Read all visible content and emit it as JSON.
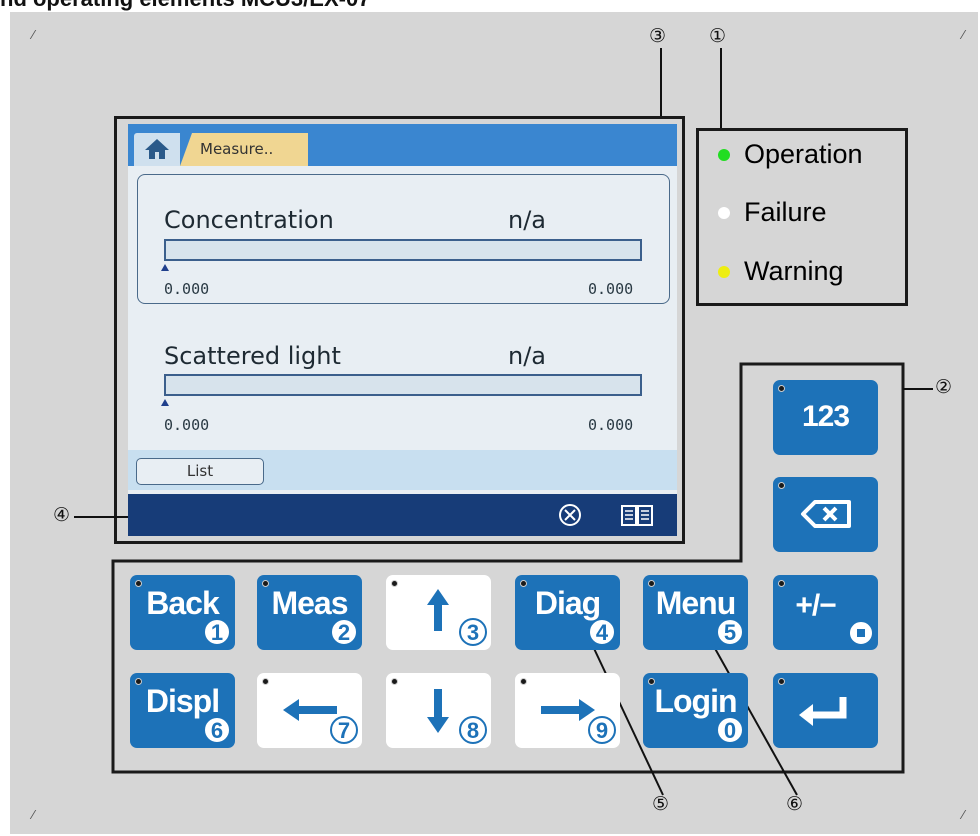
{
  "header": {
    "title": "nd operating elements MCU3/EX-07"
  },
  "callouts": {
    "c1": "①",
    "c2": "②",
    "c3": "③",
    "c4": "④",
    "c5": "⑤",
    "c6": "⑥"
  },
  "display": {
    "breadcrumb": "Measure..",
    "measurements": [
      {
        "label": "Concentration",
        "value": "n/a",
        "scale_min": "0.000",
        "scale_max": "0.000",
        "level": 0
      },
      {
        "label": "Scattered light",
        "value": "n/a",
        "scale_min": "0.000",
        "scale_max": "0.000",
        "level": 0
      }
    ],
    "list_button": "List"
  },
  "leds": [
    {
      "label": "Operation",
      "color": "#22dd22"
    },
    {
      "label": "Failure",
      "color": "#ffffff"
    },
    {
      "label": "Warning",
      "color": "#eeee11"
    }
  ],
  "keys": {
    "back": {
      "label": "Back",
      "num": "1"
    },
    "meas": {
      "label": "Meas",
      "num": "2"
    },
    "up": {
      "num": "3"
    },
    "diag": {
      "label": "Diag",
      "num": "4"
    },
    "menu": {
      "label": "Menu",
      "num": "5"
    },
    "displ": {
      "label": "Displ",
      "num": "6"
    },
    "left": {
      "num": "7"
    },
    "down": {
      "num": "8"
    },
    "right": {
      "num": "9"
    },
    "login": {
      "label": "Login",
      "num": "0"
    },
    "num_mode": {
      "label": "123"
    },
    "plusminus": {
      "label": "+/−"
    }
  },
  "colors": {
    "key_blue": "#1d72b8",
    "plate": "#d6d6d6",
    "display_bar": "#173c78"
  }
}
